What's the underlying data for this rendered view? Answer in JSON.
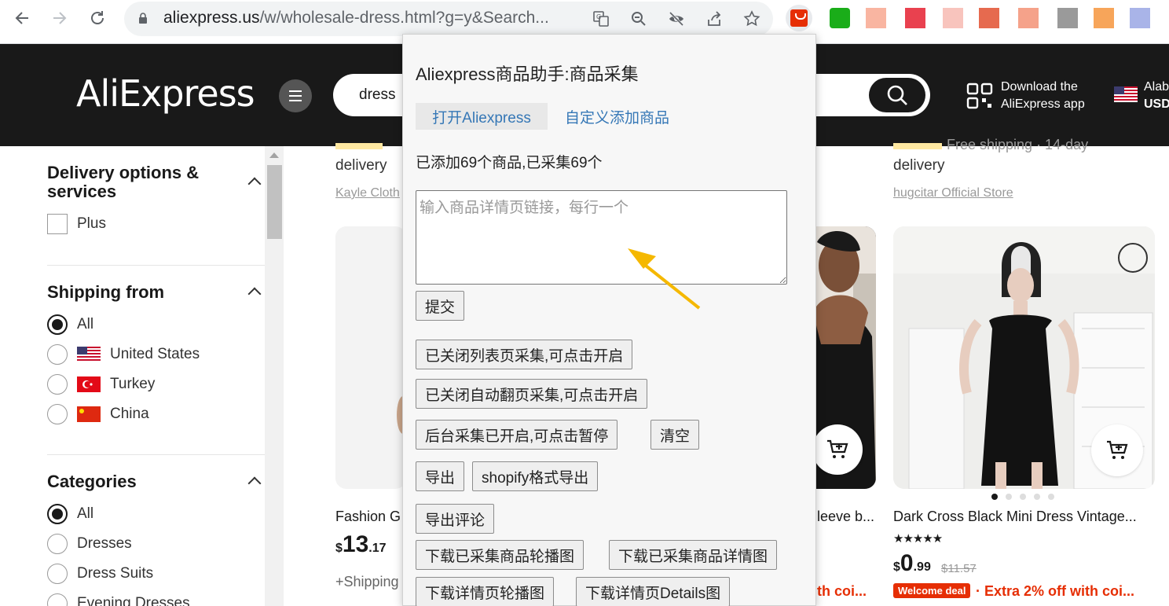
{
  "browser": {
    "url_host": "aliexpress.us",
    "url_path": "/w/wholesale-dress.html?g=y&Search..."
  },
  "header": {
    "logo": "AliExpress",
    "search_value": "dress",
    "app_line1": "Download the",
    "app_line2": "AliExpress app",
    "lang_line1": "Alab",
    "lang_line2": "USD"
  },
  "filters": {
    "delivery": {
      "title_line1": "Delivery options &",
      "title_line2": "services",
      "options": [
        "Plus"
      ]
    },
    "shipping_from": {
      "title": "Shipping from",
      "options": [
        "All",
        "United States",
        "Turkey",
        "China"
      ]
    },
    "categories": {
      "title": "Categories",
      "options": [
        "All",
        "Dresses",
        "Dress Suits",
        "Evening Dresses"
      ]
    }
  },
  "products": {
    "top_left_snippet": "delivery",
    "top_left_store": "Kayle Cloth",
    "top_right_snippet": "delivery",
    "top_right_snippet_cut": "Free shipping · 14-day",
    "top_right_store": "hugcitar Official Store",
    "card1": {
      "title": "Fashion G",
      "price_currency": "$",
      "price_int": "13",
      "price_cents": ".17",
      "shipping": "+Shipping"
    },
    "card2": {
      "title": "leeve b...",
      "extra": "th coi..."
    },
    "card3": {
      "title": "Dark Cross Black Mini Dress Vintage...",
      "stars": "★★★★★",
      "price_currency": "$",
      "price_int": "0",
      "price_cents": ".99",
      "old_price": "$11.57",
      "welcome": "Welcome deal",
      "extra": "· Extra 2% off with coi..."
    }
  },
  "popup": {
    "title": "Aliexpress商品助手:商品采集",
    "tab_open": "打开Aliexpress",
    "tab_custom": "自定义添加商品",
    "status": "已添加69个商品,已采集69个",
    "textarea_placeholder": "输入商品详情页链接，每行一个",
    "submit": "提交",
    "btn_list_collect": "已关闭列表页采集,可点击开启",
    "btn_auto_page": "已关闭自动翻页采集,可点击开启",
    "btn_background": "后台采集已开启,可点击暂停",
    "btn_clear": "清空",
    "btn_export": "导出",
    "btn_shopify": "shopify格式导出",
    "btn_export_reviews": "导出评论",
    "btn_dl_collected_carousel": "下载已采集商品轮播图",
    "btn_dl_collected_detail": "下载已采集商品详情图",
    "btn_dl_page_carousel": "下载详情页轮播图",
    "btn_dl_page_details": "下载详情页Details图"
  },
  "colors": {
    "accent_red": "#e62e04",
    "header_black": "#191919",
    "link_blue": "#3577b6",
    "arrow_yellow": "#f5b800"
  }
}
